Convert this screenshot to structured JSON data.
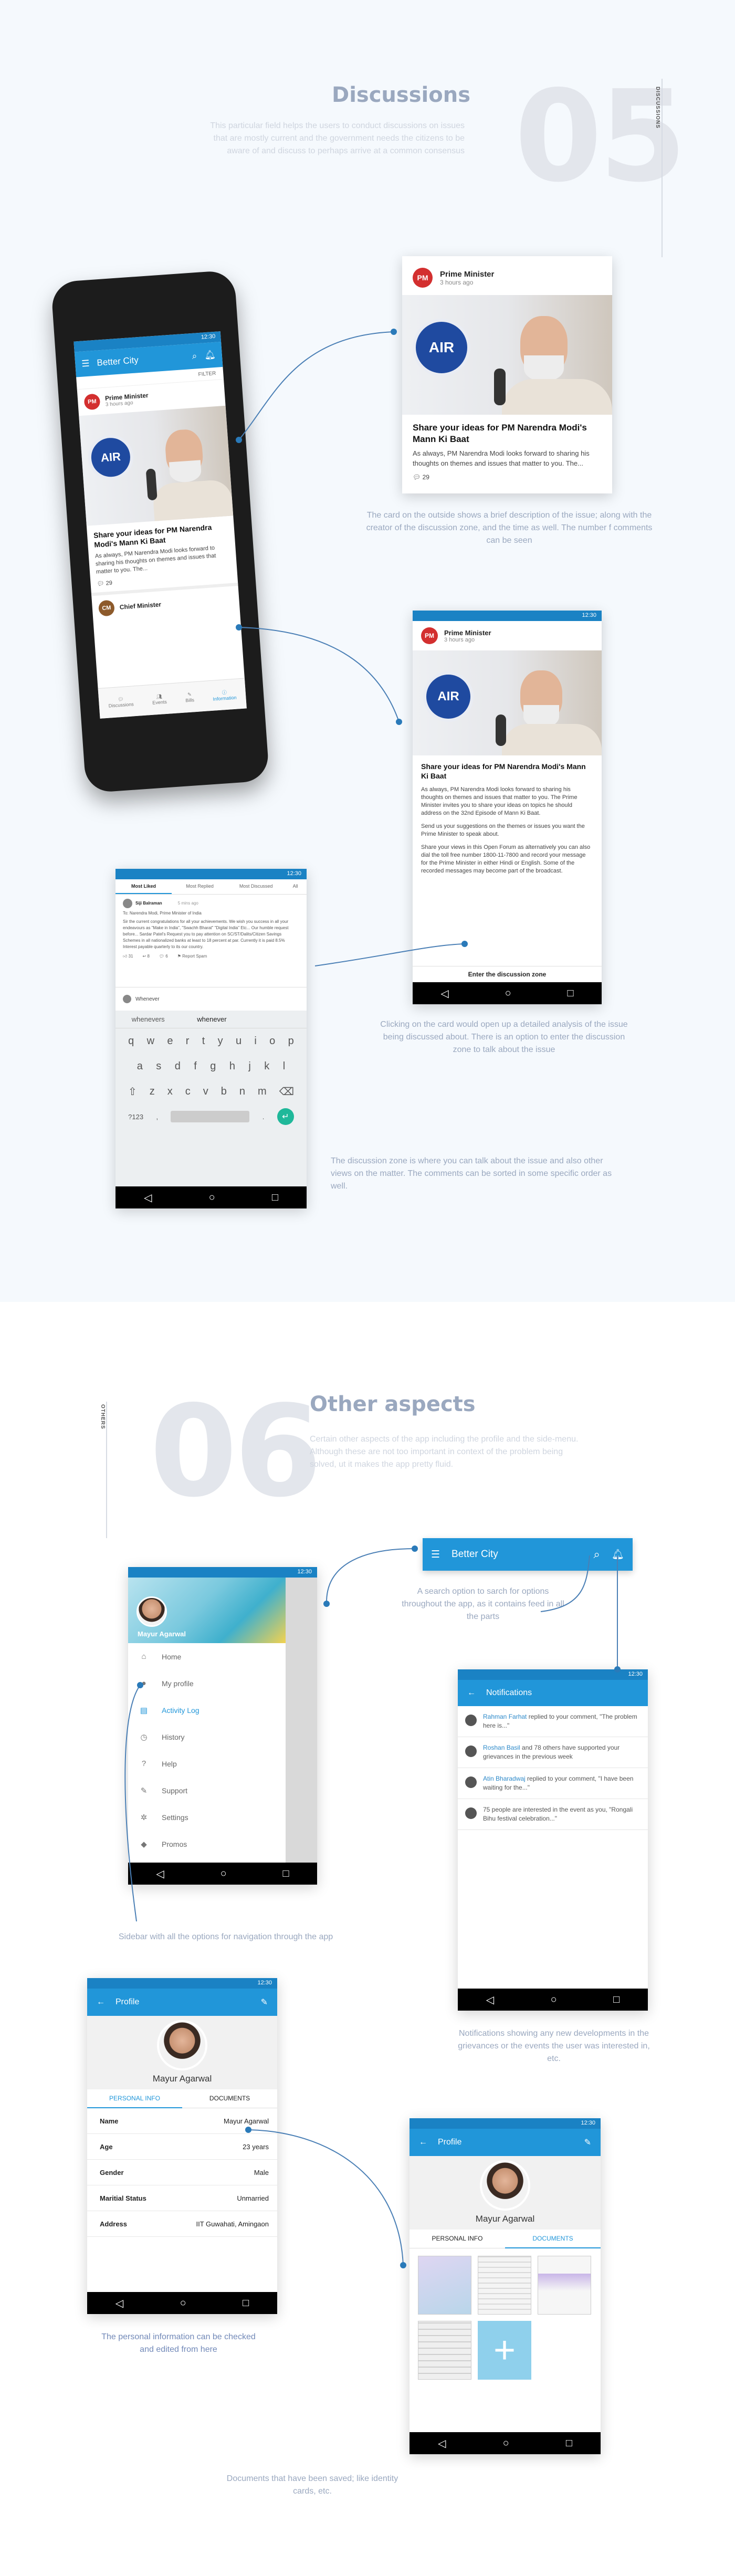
{
  "section5": {
    "number": "05",
    "title": "Discussions",
    "description": "This particular field helps the users to conduct discussions on issues that are mostly current and the government needs the citizens to be aware of and discuss to perhaps arrive at a common consensus",
    "side_label": "DISCUSSIONS",
    "phone": {
      "status_time": "12:30",
      "app_title": "Better City",
      "sort_label": "FILTER",
      "author": "Prime Minister",
      "time": "3 hours ago",
      "headline": "Share your ideas for PM Narendra Modi's Mann Ki Baat",
      "excerpt": "As always, PM Narendra Modi looks forward to sharing his thoughts on themes and issues that matter to you. The...",
      "comments": "29",
      "next_author": "Chief Minister",
      "bottom_nav": [
        "Discussions",
        "Events",
        "Bills",
        "Information"
      ]
    },
    "card": {
      "author": "Prime Minister",
      "time": "3 hours ago",
      "headline": "Share your ideas for PM Narendra Modi's Mann Ki Baat",
      "excerpt": "As always, PM Narendra Modi looks forward to sharing his thoughts on themes and issues that matter to you. The...",
      "comments": "29"
    },
    "detail": {
      "status_time": "12:30",
      "author": "Prime Minister",
      "time": "3 hours ago",
      "headline": "Share your ideas for PM Narendra Modi's Mann Ki Baat",
      "para1": "As always, PM Narendra Modi looks forward to sharing his thoughts on themes and issues that matter to you. The Prime Minister invites you to share your ideas on topics he should address on the 32nd Episode of Mann Ki Baat.",
      "para2": "Send us your suggestions on the themes or issues you want the Prime Minister to speak about.",
      "para3": "Share your views in this Open Forum as alternatively you can also dial the toll free number 1800-11-7800 and record your message for the Prime Minister in either Hindi or English. Some of the recorded messages may become part of the broadcast.",
      "cta": "Enter the discussion zone"
    },
    "zone": {
      "status_time": "12:30",
      "tabs": [
        "Most Liked",
        "Most Replied",
        "Most Discussed",
        "All"
      ],
      "commenter": "Siji Balraman",
      "commenter_time": "5 mins ago",
      "to_line": "To: Narendra Modi, Prime Minister of India",
      "comment": "Sir the current congratulations for all your achievements. We wish you success in all your endeavours as \"Make in India\", \"Swachh Bharat\" \"Digital India\" Etc... Our humble request before... Sardar Patel's Request you to pay attention on SC/ST/Dalits/Citizen Savings Schemes in all nationalized banks at least to 18 percent at par. Currently it is paid 8.5% Interest payable quarterly to its our country.",
      "stats": [
        "31",
        "8",
        "6",
        "Report Spam"
      ],
      "input_value": "Whenever",
      "suggestions": [
        "whenevers",
        "whenever"
      ],
      "kbd_row1": [
        "q",
        "w",
        "e",
        "r",
        "t",
        "y",
        "u",
        "i",
        "o",
        "p"
      ],
      "kbd_row2": [
        "a",
        "s",
        "d",
        "f",
        "g",
        "h",
        "j",
        "k",
        "l"
      ],
      "kbd_row3": [
        "z",
        "x",
        "c",
        "v",
        "b",
        "n",
        "m"
      ],
      "kbd_sym": "?123"
    },
    "captions": {
      "card": "The card on the outside shows a brief description of the issue; along with the creator of the discussion zone, and the time as well. The number f comments can be seen",
      "detail": "Clicking on the card would open up a detailed analysis of the issue being discussed about. There is an option to enter the discussion zone to talk about the issue",
      "zone": "The discussion zone is where you can talk about the issue and also other views on the matter. The comments can be sorted in some specific order as well."
    }
  },
  "section6": {
    "number": "06",
    "title": "Other aspects",
    "description": "Certain other aspects of the app including the profile and the side-menu. Although these are not too important in context of the problem being solved, ut it makes the app pretty fluid.",
    "side_label": "OTHERS",
    "sidebar": {
      "status_time": "12:30",
      "user": "Mayur Agarwal",
      "items": [
        {
          "label": "Home",
          "icon": "home-icon",
          "glyph": "⌂"
        },
        {
          "label": "My profile",
          "icon": "person-icon",
          "glyph": "●"
        },
        {
          "label": "Activity Log",
          "icon": "clipboard-icon",
          "glyph": "▤"
        },
        {
          "label": "History",
          "icon": "history-icon",
          "glyph": "◷"
        },
        {
          "label": "Help",
          "icon": "help-icon",
          "glyph": "?"
        },
        {
          "label": "Support",
          "icon": "wrench-icon",
          "glyph": "✎"
        },
        {
          "label": "Settings",
          "icon": "gear-icon",
          "glyph": "✲"
        },
        {
          "label": "Promos",
          "icon": "tag-icon",
          "glyph": "◆"
        }
      ],
      "active_index": 2
    },
    "searchbar": {
      "title": "Better City"
    },
    "notifications": {
      "status_time": "12:30",
      "title": "Notifications",
      "items": [
        {
          "who": "Rahman Farhat",
          "text": " replied to your comment, \"The problem here is...\""
        },
        {
          "who": "Roshan Basil",
          "text": " and 78 others have supported your grievances in the previous week"
        },
        {
          "who": "Atin Bharadwaj",
          "text": " replied to your comment, \"I have been waiting for the...\""
        },
        {
          "who": "",
          "text": "75 people are interested in the event as you, \"Rongali Bihu festival celebration...\""
        }
      ]
    },
    "profile": {
      "status_time": "12:30",
      "title": "Profile",
      "name": "Mayur Agarwal",
      "tabs": [
        "PERSONAL INFO",
        "DOCUMENTS"
      ],
      "rows": [
        {
          "k": "Name",
          "v": "Mayur Agarwal"
        },
        {
          "k": "Age",
          "v": "23 years"
        },
        {
          "k": "Gender",
          "v": "Male"
        },
        {
          "k": "Maritial Status",
          "v": "Unmarried"
        },
        {
          "k": "Address",
          "v": "IIT Guwahati, Amingaon"
        }
      ]
    },
    "docs": {
      "status_time": "12:30",
      "title": "Profile",
      "name": "Mayur Agarwal",
      "tabs": [
        "PERSONAL INFO",
        "DOCUMENTS"
      ],
      "add_glyph": "+"
    },
    "captions": {
      "search": "A search option to sarch for options throughout the app, as it contains feed in all the parts",
      "sidebar": "Sidebar with all the options for navigation through the app",
      "notifications": "Notifications showing any new developments in the grievances or the events the user was interested in, etc.",
      "profile": "The personal information can be checked and edited from here",
      "docs": "Documents that have been saved; like identity cards, etc."
    }
  },
  "colors": {
    "brand_blue": "#2196d9",
    "status_blue": "#1a82c4",
    "heading_grey": "#9aa8bf"
  },
  "nav_glyphs": [
    "◁",
    "○",
    "□"
  ]
}
